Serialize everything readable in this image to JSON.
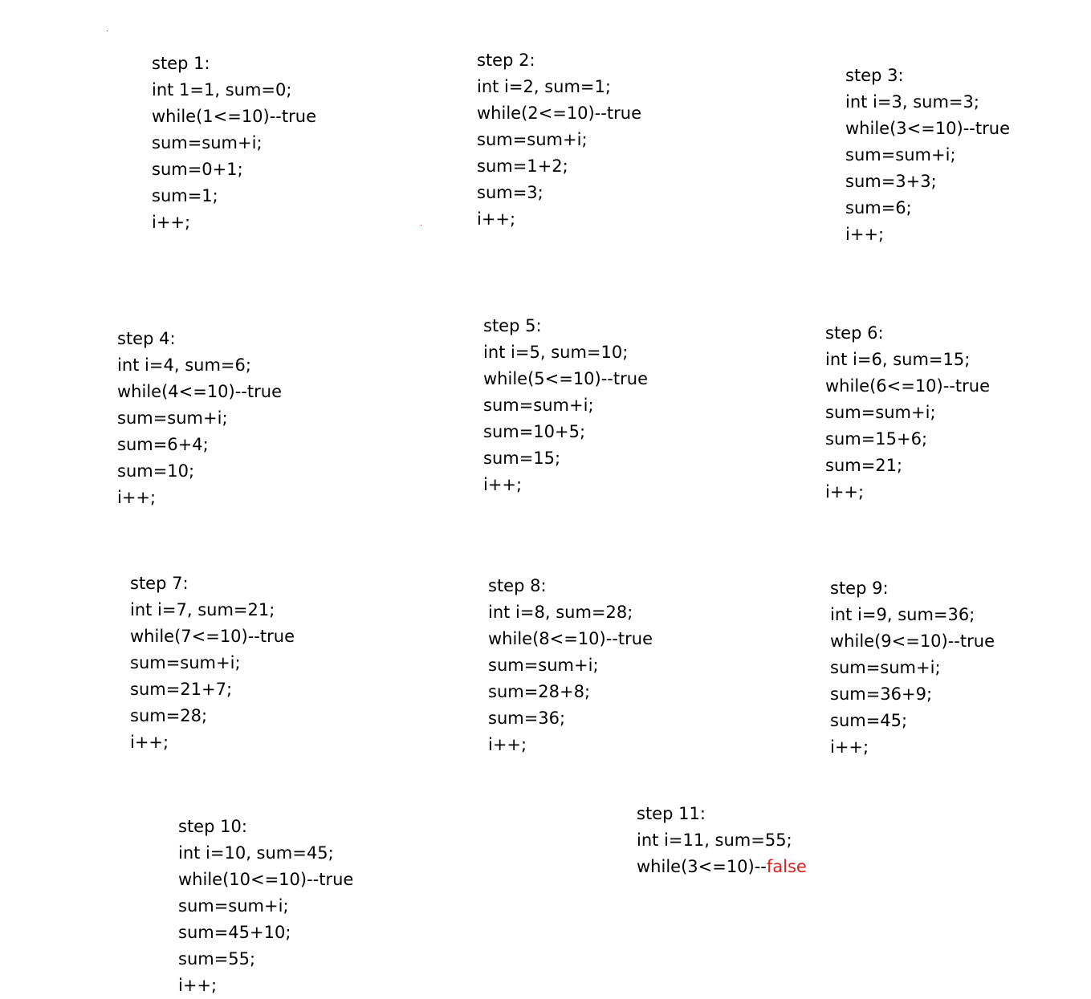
{
  "steps": [
    {
      "title": "step 1:",
      "lines": [
        "int 1=1, sum=0;",
        "while(1<=10)--true",
        "sum=sum+i;",
        "sum=0+1;",
        "sum=1;",
        "i++;"
      ]
    },
    {
      "title": "step 2:",
      "lines": [
        "int i=2, sum=1;",
        "while(2<=10)--true",
        "sum=sum+i;",
        "sum=1+2;",
        "sum=3;",
        "i++;"
      ]
    },
    {
      "title": "step 3:",
      "lines": [
        "int i=3, sum=3;",
        "while(3<=10)--true",
        "sum=sum+i;",
        "sum=3+3;",
        "sum=6;",
        "i++;"
      ]
    },
    {
      "title": "step 4:",
      "lines": [
        "int i=4, sum=6;",
        "while(4<=10)--true",
        "sum=sum+i;",
        "sum=6+4;",
        "sum=10;",
        "i++;"
      ]
    },
    {
      "title": "step 5:",
      "lines": [
        "int i=5, sum=10;",
        "while(5<=10)--true",
        "sum=sum+i;",
        "sum=10+5;",
        "sum=15;",
        "i++;"
      ]
    },
    {
      "title": "step 6:",
      "lines": [
        "int i=6, sum=15;",
        "while(6<=10)--true",
        "sum=sum+i;",
        "sum=15+6;",
        "sum=21;",
        "i++;"
      ]
    },
    {
      "title": "step 7:",
      "lines": [
        "int i=7, sum=21;",
        "while(7<=10)--true",
        "sum=sum+i;",
        "sum=21+7;",
        "sum=28;",
        "i++;"
      ]
    },
    {
      "title": "step 8:",
      "lines": [
        "int i=8, sum=28;",
        "while(8<=10)--true",
        "sum=sum+i;",
        "sum=28+8;",
        "sum=36;",
        "i++;"
      ]
    },
    {
      "title": "step 9:",
      "lines": [
        "int i=9, sum=36;",
        "while(9<=10)--true",
        "sum=sum+i;",
        "sum=36+9;",
        "sum=45;",
        "i++;"
      ]
    },
    {
      "title": "step 10:",
      "lines": [
        "int i=10, sum=45;",
        "while(10<=10)--true",
        "sum=sum+i;",
        "sum=45+10;",
        "sum=55;",
        "i++;"
      ]
    },
    {
      "title": "step 11:",
      "lines": [
        "int i=11, sum=55;"
      ],
      "condition_prefix": "while(3<=10)--",
      "condition_result": "false"
    }
  ],
  "colors": {
    "text": "#000000",
    "false_highlight": "#e02020",
    "background": "#ffffff"
  }
}
